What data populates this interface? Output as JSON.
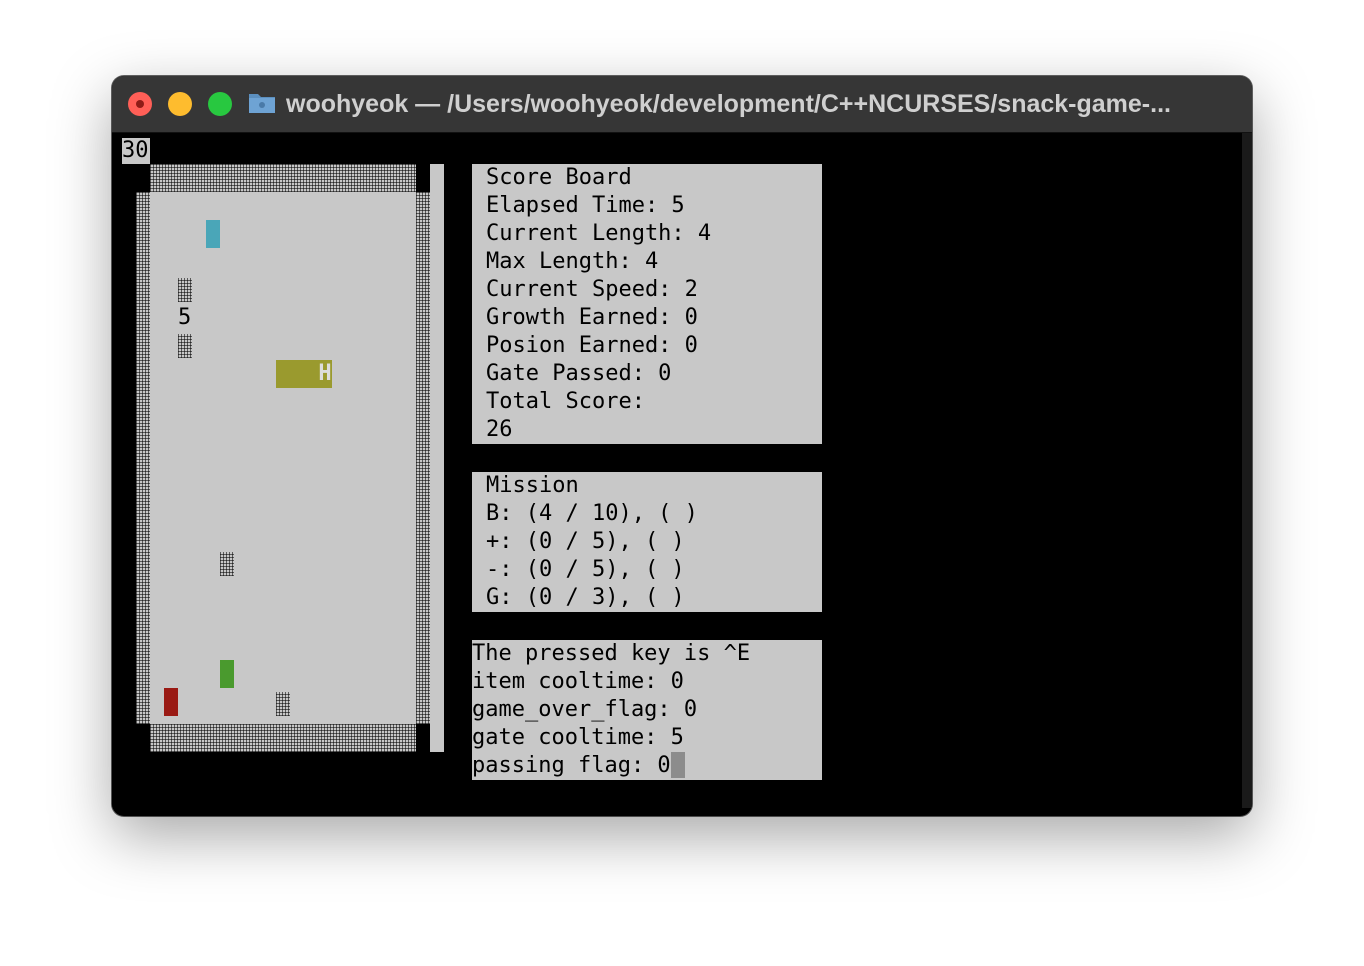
{
  "window": {
    "title": "woohyeok — /Users/woohyeok/development/C++NCURSES/snack-game-...",
    "traffic_lights": {
      "close": "#ff5f57",
      "minimize": "#febc2e",
      "zoom": "#28c840"
    }
  },
  "terminal": {
    "counter": "30",
    "board": {
      "head_char": "H",
      "number_item": "5",
      "colors": {
        "snake": "#9a9a2e",
        "growth_item": "#4a9a2e",
        "poison_item": "#9a1a14",
        "gate": "#4aa6b8",
        "floor": "#c8c8c8"
      }
    },
    "score_board": {
      "title": "Score Board",
      "elapsed": "Elapsed Time: 5",
      "current_length": "Current Length: 4",
      "max_length": "Max Length: 4",
      "current_speed": "Current Speed: 2",
      "growth": "Growth Earned: 0",
      "poison": "Posion Earned: 0",
      "gate": "Gate Passed: 0",
      "total_label": "Total Score:",
      "total_value": "26"
    },
    "mission": {
      "title": "Mission",
      "b": "B: (4 / 10), ( )",
      "plus": "+: (0 / 5), ( )",
      "minus": "-: (0 / 5), ( )",
      "g": "G: (0 / 3), ( )"
    },
    "debug": {
      "pressed_key": "The pressed key is ^E",
      "item_cooltime": "item cooltime: 0",
      "game_over_flag": "game_over_flag: 0",
      "gate_cooltime": "gate cooltime: 5",
      "passing_flag": "passing flag: 0"
    }
  }
}
